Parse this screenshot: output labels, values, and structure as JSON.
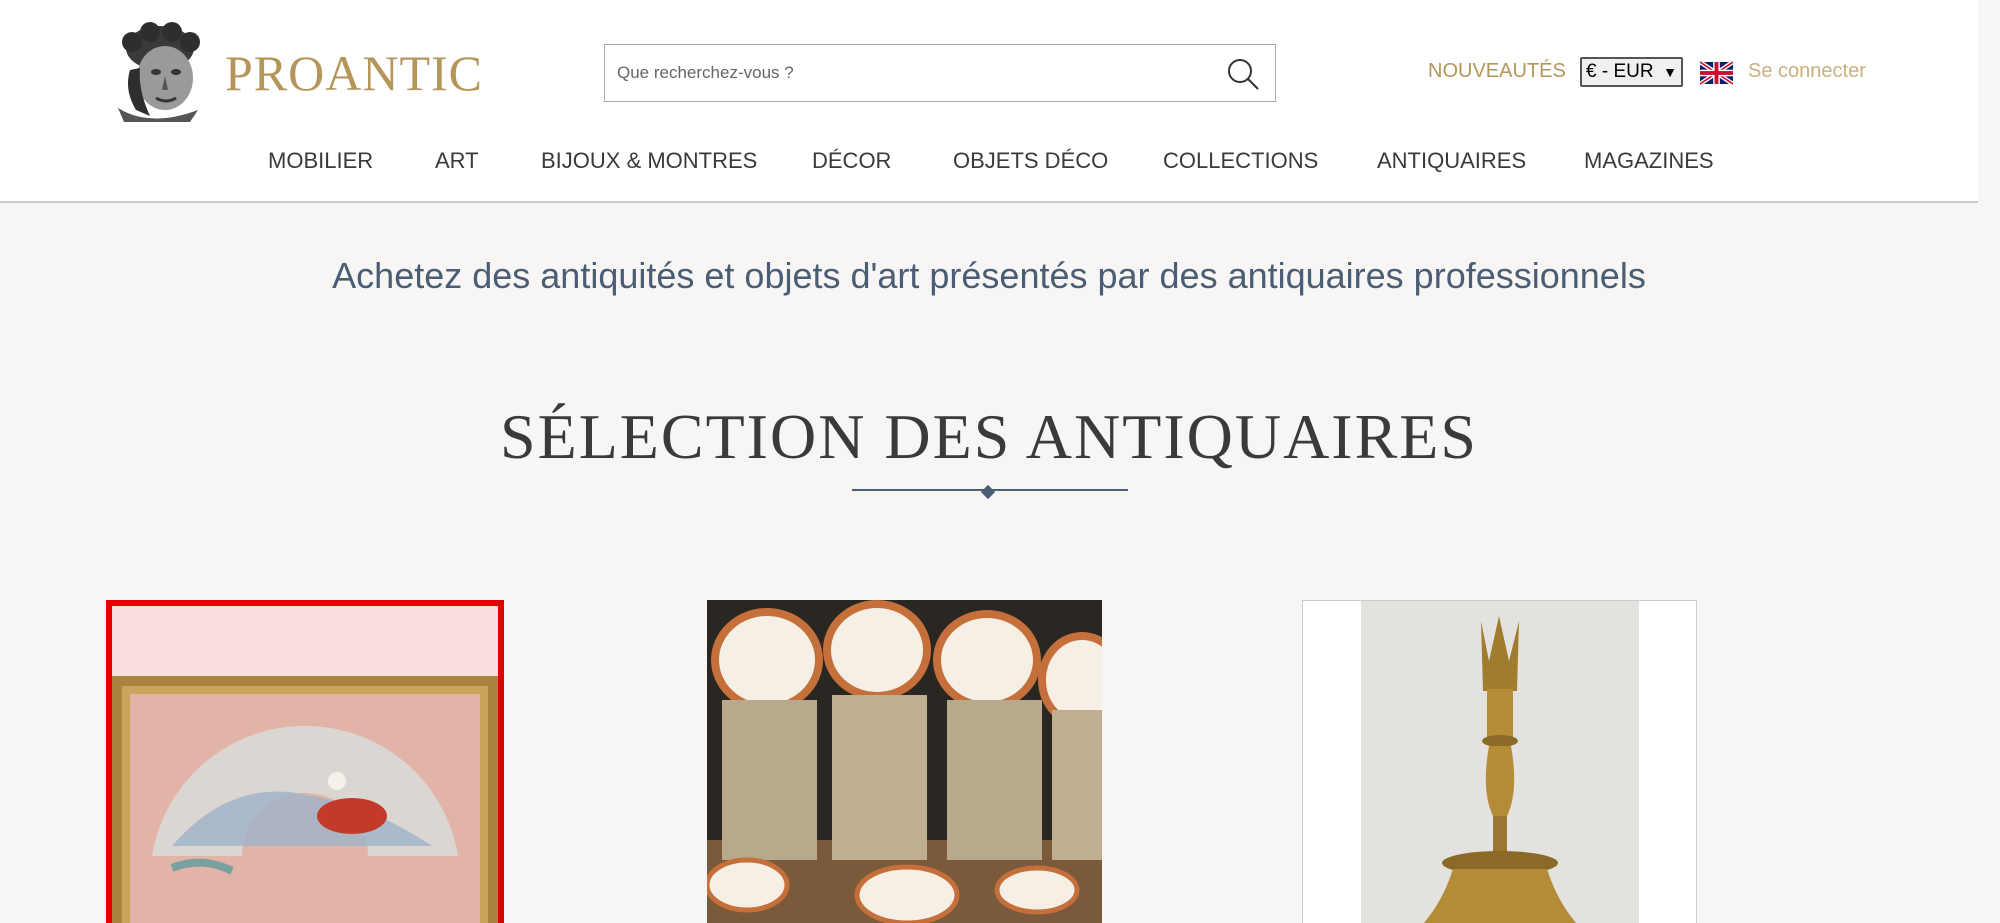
{
  "brand": {
    "name": "PROANTIC"
  },
  "search": {
    "placeholder": "Que recherchez-vous ?"
  },
  "header_links": {
    "new_label": "NOUVEAUTÉS",
    "currency": "€ - EUR",
    "login_label": "Se connecter"
  },
  "nav": {
    "items": [
      {
        "label": "MOBILIER"
      },
      {
        "label": "ART"
      },
      {
        "label": "BIJOUX & MONTRES"
      },
      {
        "label": "DÉCOR"
      },
      {
        "label": "OBJETS DÉCO"
      },
      {
        "label": "COLLECTIONS"
      },
      {
        "label": "ANTIQUAIRES"
      },
      {
        "label": "MAGAZINES"
      }
    ]
  },
  "main": {
    "tagline": "Achetez des antiquités et objets d'art présentés par des antiquaires professionnels",
    "section_title": "SÉLECTION DES ANTIQUAIRES"
  },
  "colors": {
    "brand_gold": "#b5965a",
    "login_gold": "#c9b07e",
    "tagline_blue": "#4b5d75",
    "highlight_red": "#e00000"
  },
  "icons": {
    "search": "search-icon",
    "flag": "uk-flag-icon",
    "logo": "statue-head-logo"
  }
}
